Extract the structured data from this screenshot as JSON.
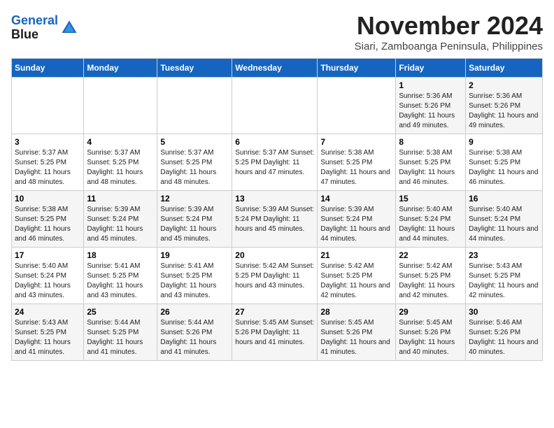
{
  "logo": {
    "line1": "General",
    "line2": "Blue"
  },
  "title": "November 2024",
  "subtitle": "Siari, Zamboanga Peninsula, Philippines",
  "days_of_week": [
    "Sunday",
    "Monday",
    "Tuesday",
    "Wednesday",
    "Thursday",
    "Friday",
    "Saturday"
  ],
  "weeks": [
    [
      {
        "day": "",
        "info": ""
      },
      {
        "day": "",
        "info": ""
      },
      {
        "day": "",
        "info": ""
      },
      {
        "day": "",
        "info": ""
      },
      {
        "day": "",
        "info": ""
      },
      {
        "day": "1",
        "info": "Sunrise: 5:36 AM\nSunset: 5:26 PM\nDaylight: 11 hours and 49 minutes."
      },
      {
        "day": "2",
        "info": "Sunrise: 5:36 AM\nSunset: 5:26 PM\nDaylight: 11 hours and 49 minutes."
      }
    ],
    [
      {
        "day": "3",
        "info": "Sunrise: 5:37 AM\nSunset: 5:25 PM\nDaylight: 11 hours and 48 minutes."
      },
      {
        "day": "4",
        "info": "Sunrise: 5:37 AM\nSunset: 5:25 PM\nDaylight: 11 hours and 48 minutes."
      },
      {
        "day": "5",
        "info": "Sunrise: 5:37 AM\nSunset: 5:25 PM\nDaylight: 11 hours and 48 minutes."
      },
      {
        "day": "6",
        "info": "Sunrise: 5:37 AM\nSunset: 5:25 PM\nDaylight: 11 hours and 47 minutes."
      },
      {
        "day": "7",
        "info": "Sunrise: 5:38 AM\nSunset: 5:25 PM\nDaylight: 11 hours and 47 minutes."
      },
      {
        "day": "8",
        "info": "Sunrise: 5:38 AM\nSunset: 5:25 PM\nDaylight: 11 hours and 46 minutes."
      },
      {
        "day": "9",
        "info": "Sunrise: 5:38 AM\nSunset: 5:25 PM\nDaylight: 11 hours and 46 minutes."
      }
    ],
    [
      {
        "day": "10",
        "info": "Sunrise: 5:38 AM\nSunset: 5:25 PM\nDaylight: 11 hours and 46 minutes."
      },
      {
        "day": "11",
        "info": "Sunrise: 5:39 AM\nSunset: 5:24 PM\nDaylight: 11 hours and 45 minutes."
      },
      {
        "day": "12",
        "info": "Sunrise: 5:39 AM\nSunset: 5:24 PM\nDaylight: 11 hours and 45 minutes."
      },
      {
        "day": "13",
        "info": "Sunrise: 5:39 AM\nSunset: 5:24 PM\nDaylight: 11 hours and 45 minutes."
      },
      {
        "day": "14",
        "info": "Sunrise: 5:39 AM\nSunset: 5:24 PM\nDaylight: 11 hours and 44 minutes."
      },
      {
        "day": "15",
        "info": "Sunrise: 5:40 AM\nSunset: 5:24 PM\nDaylight: 11 hours and 44 minutes."
      },
      {
        "day": "16",
        "info": "Sunrise: 5:40 AM\nSunset: 5:24 PM\nDaylight: 11 hours and 44 minutes."
      }
    ],
    [
      {
        "day": "17",
        "info": "Sunrise: 5:40 AM\nSunset: 5:24 PM\nDaylight: 11 hours and 43 minutes."
      },
      {
        "day": "18",
        "info": "Sunrise: 5:41 AM\nSunset: 5:25 PM\nDaylight: 11 hours and 43 minutes."
      },
      {
        "day": "19",
        "info": "Sunrise: 5:41 AM\nSunset: 5:25 PM\nDaylight: 11 hours and 43 minutes."
      },
      {
        "day": "20",
        "info": "Sunrise: 5:42 AM\nSunset: 5:25 PM\nDaylight: 11 hours and 43 minutes."
      },
      {
        "day": "21",
        "info": "Sunrise: 5:42 AM\nSunset: 5:25 PM\nDaylight: 11 hours and 42 minutes."
      },
      {
        "day": "22",
        "info": "Sunrise: 5:42 AM\nSunset: 5:25 PM\nDaylight: 11 hours and 42 minutes."
      },
      {
        "day": "23",
        "info": "Sunrise: 5:43 AM\nSunset: 5:25 PM\nDaylight: 11 hours and 42 minutes."
      }
    ],
    [
      {
        "day": "24",
        "info": "Sunrise: 5:43 AM\nSunset: 5:25 PM\nDaylight: 11 hours and 41 minutes."
      },
      {
        "day": "25",
        "info": "Sunrise: 5:44 AM\nSunset: 5:25 PM\nDaylight: 11 hours and 41 minutes."
      },
      {
        "day": "26",
        "info": "Sunrise: 5:44 AM\nSunset: 5:26 PM\nDaylight: 11 hours and 41 minutes."
      },
      {
        "day": "27",
        "info": "Sunrise: 5:45 AM\nSunset: 5:26 PM\nDaylight: 11 hours and 41 minutes."
      },
      {
        "day": "28",
        "info": "Sunrise: 5:45 AM\nSunset: 5:26 PM\nDaylight: 11 hours and 41 minutes."
      },
      {
        "day": "29",
        "info": "Sunrise: 5:45 AM\nSunset: 5:26 PM\nDaylight: 11 hours and 40 minutes."
      },
      {
        "day": "30",
        "info": "Sunrise: 5:46 AM\nSunset: 5:26 PM\nDaylight: 11 hours and 40 minutes."
      }
    ]
  ]
}
